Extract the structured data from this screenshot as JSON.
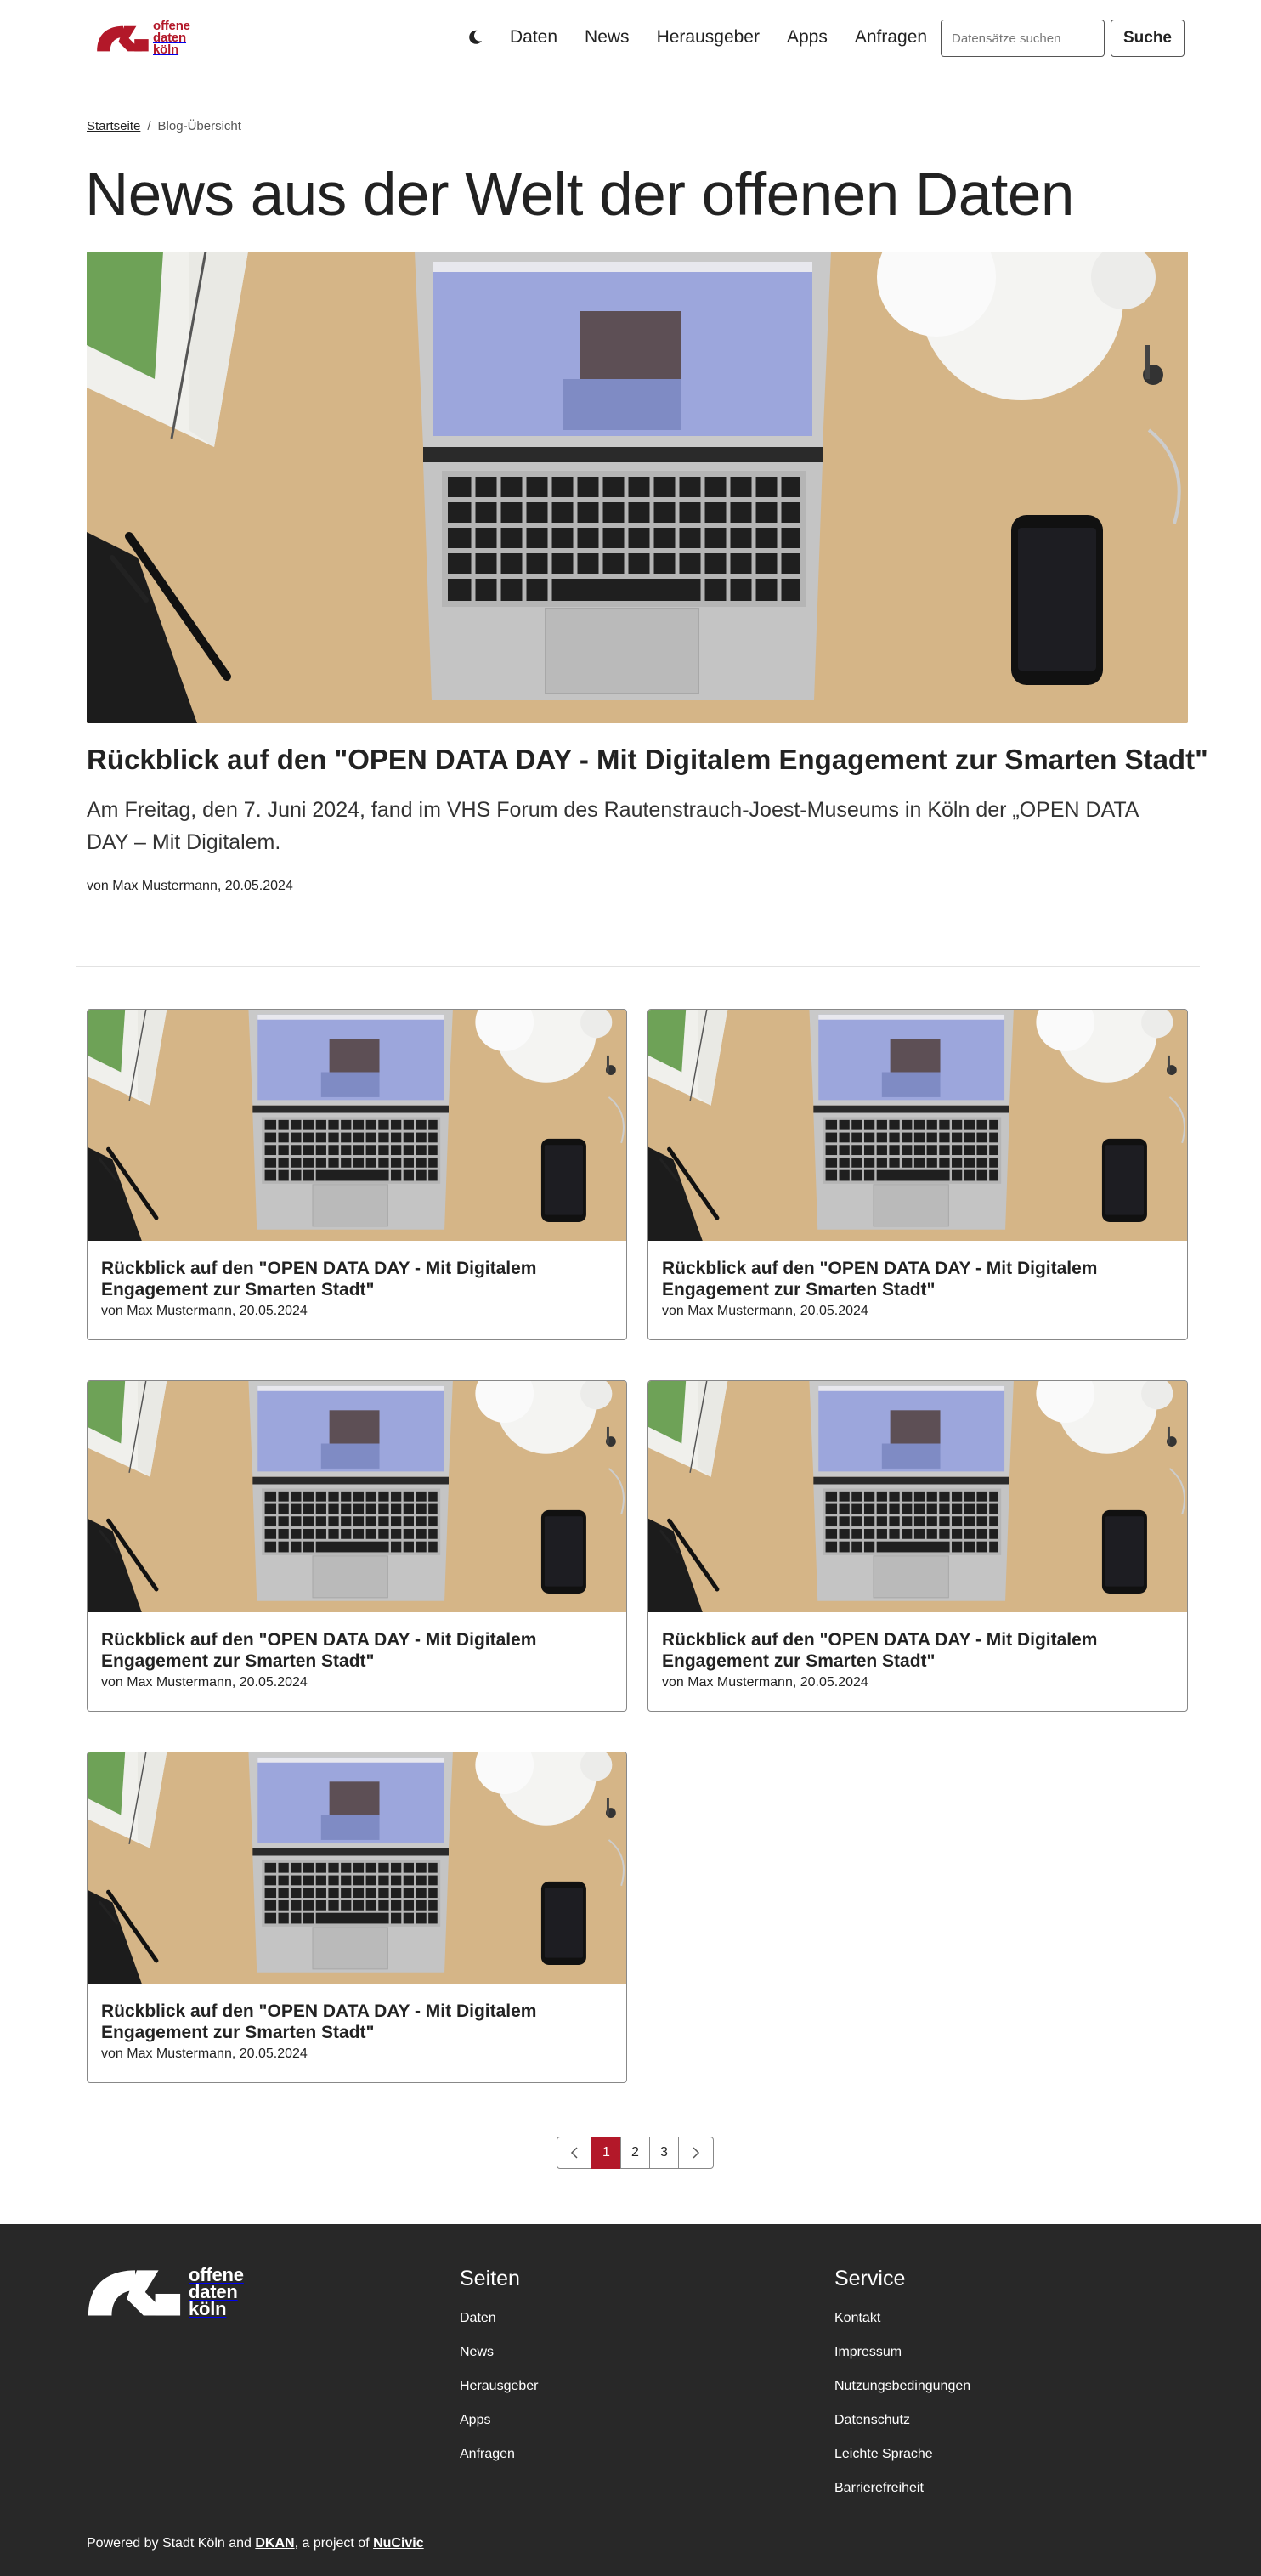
{
  "header": {
    "logo_lines": [
      "offene",
      "daten",
      "köln"
    ],
    "nav": [
      "Daten",
      "News",
      "Herausgeber",
      "Apps",
      "Anfragen"
    ],
    "search_placeholder": "Datensätze suchen",
    "search_button": "Suche",
    "theme_icon": "moon-icon"
  },
  "breadcrumb": {
    "home": "Startseite",
    "separator": "/",
    "current": "Blog-Übersicht"
  },
  "page_title": "News aus der Welt der offenen Daten",
  "featured": {
    "title": "Rückblick auf den \"OPEN DATA DAY - Mit Digitalem Engagement zur Smarten Stadt\"",
    "teaser": "Am Freitag, den 7. Juni 2024, fand im VHS Forum des Rautenstrauch-Joest-Museums in Köln der „OPEN DATA DAY – Mit Digitalem.",
    "meta": "von Max Mustermann, 20.05.2024"
  },
  "posts": [
    {
      "title": "Rückblick auf den \"OPEN DATA DAY - Mit Digitalem Engagement zur Smarten Stadt\"",
      "meta": "von Max Mustermann, 20.05.2024"
    },
    {
      "title": "Rückblick auf den \"OPEN DATA DAY - Mit Digitalem Engagement zur Smarten Stadt\"",
      "meta": "von Max Mustermann, 20.05.2024"
    },
    {
      "title": "Rückblick auf den \"OPEN DATA DAY - Mit Digitalem Engagement zur Smarten Stadt\"",
      "meta": "von Max Mustermann, 20.05.2024"
    },
    {
      "title": "Rückblick auf den \"OPEN DATA DAY - Mit Digitalem Engagement zur Smarten Stadt\"",
      "meta": "von Max Mustermann, 20.05.2024"
    },
    {
      "title": "Rückblick auf den \"OPEN DATA DAY - Mit Digitalem Engagement zur Smarten Stadt\"",
      "meta": "von Max Mustermann, 20.05.2024"
    }
  ],
  "pagination": {
    "prev_icon": "chevron-left-icon",
    "pages": [
      "1",
      "2",
      "3"
    ],
    "active": "1",
    "next_icon": "chevron-right-icon"
  },
  "footer": {
    "logo_lines": [
      "offene",
      "daten",
      "köln"
    ],
    "pages_heading": "Seiten",
    "pages_links": [
      "Daten",
      "News",
      "Herausgeber",
      "Apps",
      "Anfragen"
    ],
    "service_heading": "Service",
    "service_links": [
      "Kontakt",
      "Impressum",
      "Nutzungsbedingungen",
      "Datenschutz",
      "Leichte Sprache",
      "Barrierefreiheit"
    ],
    "powered_prefix": "Powered by Stadt Köln and ",
    "powered_link1": "DKAN",
    "powered_middle": ", a project of ",
    "powered_link2": "NuCivic"
  },
  "colors": {
    "brand": "#b31829",
    "footer_bg": "#282828",
    "desk": "#d8b98a"
  }
}
